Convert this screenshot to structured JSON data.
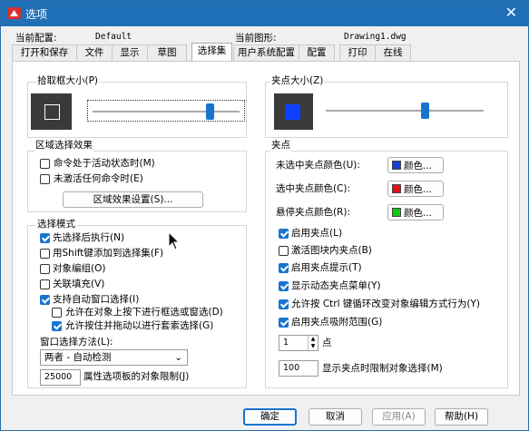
{
  "window": {
    "title": "选项",
    "close": "✕"
  },
  "info": {
    "config_label": "当前配置:",
    "config_value": "Default",
    "drawing_label": "当前图形:",
    "drawing_value": "Drawing1.dwg"
  },
  "tabs": [
    "打开和保存",
    "文件",
    "显示",
    "草图",
    "选择集",
    "用户系统配置",
    "配置",
    "打印",
    "在线"
  ],
  "active_tab": "选择集",
  "pickbox": {
    "title": "拾取框大小(P)",
    "level": 0.8
  },
  "grip_size": {
    "title": "夹点大小(Z)",
    "level": 0.63
  },
  "area_effect": {
    "title": "区域选择效果",
    "opt1": "命令处于活动状态时(M)",
    "opt2": "未激活任何命令时(E)",
    "settings_button": "区域效果设置(S)..."
  },
  "selection_modes": {
    "title": "选择模式",
    "noun_verb": "先选择后执行(N)",
    "shift_add": "用Shift键添加到选择集(F)",
    "object_group": "对象编组(O)",
    "assoc_hatch": "关联填充(V)",
    "implied_window": "支持自动窗口选择(I)",
    "press_drag": "允许在对象上按下进行框选或窗选(D)",
    "press_drag_lasso": "允许按住并拖动以进行套索选择(G)",
    "window_method_label": "窗口选择方法(L):",
    "window_method_value": "两者 - 自动检测",
    "limit_value": "25000",
    "limit_label": "属性选项板的对象限制(J)"
  },
  "grips": {
    "title": "夹点",
    "unselected_label": "未选中夹点颜色(U):",
    "selected_label": "选中夹点颜色(C):",
    "hover_label": "悬停夹点颜色(R):",
    "color_button": "颜色...",
    "unselected_color": "#1040d0",
    "selected_color": "#e01010",
    "hover_color": "#10c810",
    "show_grips": "启用夹点(L)",
    "grips_in_blocks": "激活图块内夹点(B)",
    "grip_tips": "启用夹点提示(T)",
    "dyn_menu": "显示动态夹点菜单(Y)",
    "ctrl_cycle": "允许按 Ctrl 键循环改变对象编辑方式行为(Y)",
    "grips_range": "启用夹点吸附范围(G)",
    "spin_value": "1",
    "spin_label": "点",
    "limit_value": "100",
    "limit_label": "显示夹点时限制对象选择(M)"
  },
  "footer": {
    "ok": "确定",
    "cancel": "取消",
    "apply": "应用(A)",
    "help": "帮助(H)"
  }
}
